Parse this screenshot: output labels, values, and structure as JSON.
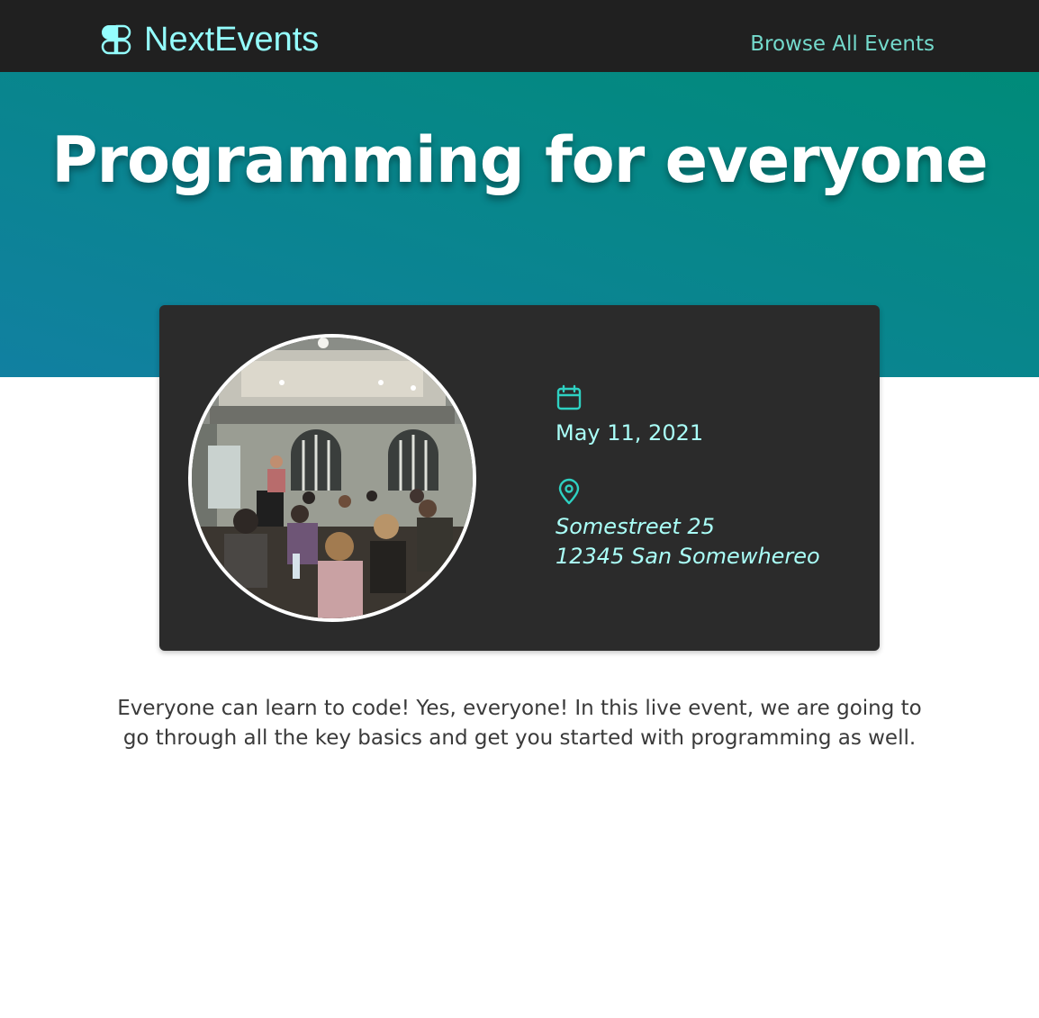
{
  "header": {
    "logo_text": "NextEvents",
    "logo_icon": "clover-logo-icon",
    "nav_link_label": "Browse All Events"
  },
  "hero": {
    "title": "Programming for everyone"
  },
  "event": {
    "date": "May 11, 2021",
    "date_icon": "calendar-icon",
    "address_line_1": "Somestreet 25",
    "address_line_2": "12345 San Somewhereo",
    "address_icon": "map-pin-icon",
    "description": "Everyone can learn to code! Yes, everyone! In this live event, we are going to go through all the key basics and get you started with programming as well."
  },
  "colors": {
    "header_bg": "#202020",
    "logo_color": "#94fdfd",
    "nav_color": "#74dacc",
    "hero_gradient_start": "#008b79",
    "hero_gradient_end": "#1180a1",
    "card_bg": "#2b2b2b",
    "icon_color": "#2ed1c2",
    "meta_text": "#aafff8"
  }
}
